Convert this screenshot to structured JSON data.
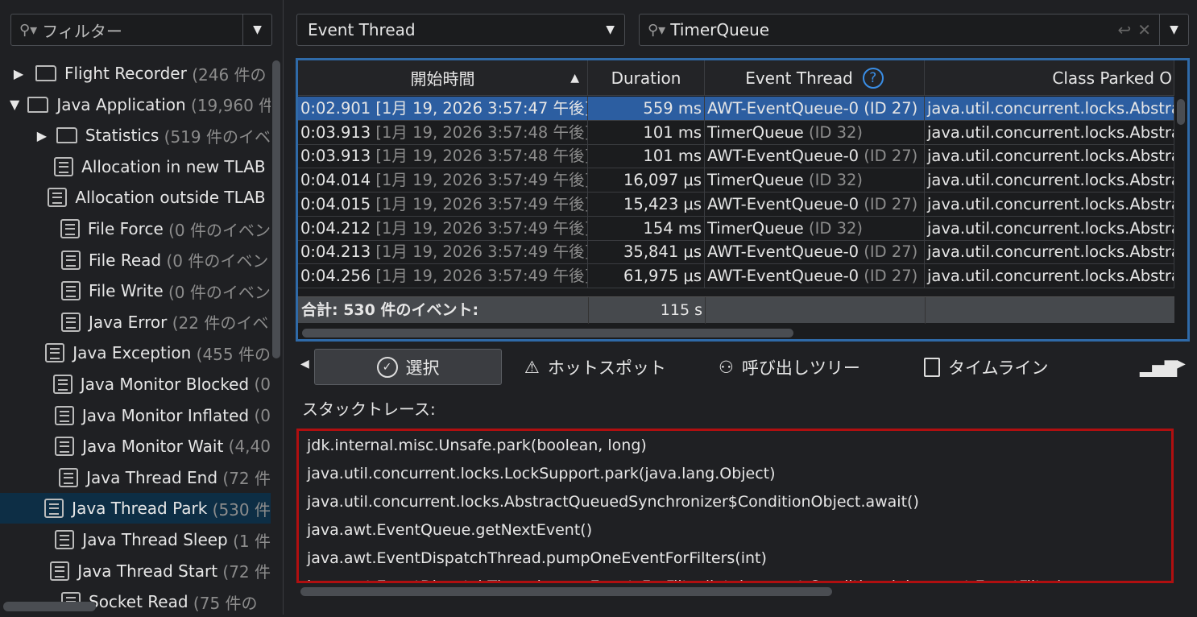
{
  "left": {
    "filter_placeholder": "フィルター",
    "tree": [
      {
        "label": "Flight Recorder",
        "count": "(246 件の",
        "level": 0,
        "type": "folder",
        "expand": "▶"
      },
      {
        "label": "Java Application",
        "count": "(19,960 件",
        "level": 0,
        "type": "folder-open",
        "expand": "▼"
      },
      {
        "label": "Statistics",
        "count": "(519 件のイベ",
        "level": 1,
        "type": "folder",
        "expand": "▶"
      },
      {
        "label": "Allocation in new TLAB",
        "count": "",
        "level": 1,
        "type": "doc"
      },
      {
        "label": "Allocation outside TLAB",
        "count": "",
        "level": 1,
        "type": "doc"
      },
      {
        "label": "File Force",
        "count": "(0 件のイベン",
        "level": 1,
        "type": "doc"
      },
      {
        "label": "File Read",
        "count": "(0 件のイベン",
        "level": 1,
        "type": "doc"
      },
      {
        "label": "File Write",
        "count": "(0 件のイベン",
        "level": 1,
        "type": "doc"
      },
      {
        "label": "Java Error",
        "count": "(22 件のイベ",
        "level": 1,
        "type": "doc"
      },
      {
        "label": "Java Exception",
        "count": "(455 件の",
        "level": 1,
        "type": "doc"
      },
      {
        "label": "Java Monitor Blocked",
        "count": "(0",
        "level": 1,
        "type": "doc"
      },
      {
        "label": "Java Monitor Inflated",
        "count": "(0",
        "level": 1,
        "type": "doc"
      },
      {
        "label": "Java Monitor Wait",
        "count": "(4,40",
        "level": 1,
        "type": "doc"
      },
      {
        "label": "Java Thread End",
        "count": "(72 件",
        "level": 1,
        "type": "doc"
      },
      {
        "label": "Java Thread Park",
        "count": "(530 件",
        "level": 1,
        "type": "doc",
        "selected": true
      },
      {
        "label": "Java Thread Sleep",
        "count": "(1 件",
        "level": 1,
        "type": "doc"
      },
      {
        "label": "Java Thread Start",
        "count": "(72 件",
        "level": 1,
        "type": "doc"
      },
      {
        "label": "Socket Read",
        "count": "(75 件の",
        "level": 1,
        "type": "doc"
      }
    ]
  },
  "toolbar": {
    "thread_select": "Event Thread",
    "search_value": "TimerQueue"
  },
  "table": {
    "headers": [
      "開始時間",
      "Duration",
      "Event Thread",
      "Class Parked O"
    ],
    "sort_indicator": "▲",
    "help_icon": "?",
    "rows": [
      {
        "time": "0:02.901",
        "date": "[1月 19, 2026 3:57:47 午後]",
        "duration": "559 ms",
        "thread": "AWT-EventQueue-0",
        "id": "(ID 27)",
        "class": "java.util.concurrent.locks.Abstrac",
        "selected": true
      },
      {
        "time": "0:03.913",
        "date": "[1月 19, 2026 3:57:48 午後]",
        "duration": "101 ms",
        "thread": "TimerQueue",
        "id": "(ID 32)",
        "class": "java.util.concurrent.locks.Abstrac"
      },
      {
        "time": "0:03.913",
        "date": "[1月 19, 2026 3:57:48 午後]",
        "duration": "101 ms",
        "thread": "AWT-EventQueue-0",
        "id": "(ID 27)",
        "class": "java.util.concurrent.locks.Abstrac"
      },
      {
        "time": "0:04.014",
        "date": "[1月 19, 2026 3:57:49 午後]",
        "duration": "16,097 μs",
        "thread": "TimerQueue",
        "id": "(ID 32)",
        "class": "java.util.concurrent.locks.Abstrac"
      },
      {
        "time": "0:04.015",
        "date": "[1月 19, 2026 3:57:49 午後]",
        "duration": "15,423 μs",
        "thread": "AWT-EventQueue-0",
        "id": "(ID 27)",
        "class": "java.util.concurrent.locks.Abstrac"
      },
      {
        "time": "0:04.212",
        "date": "[1月 19, 2026 3:57:49 午後]",
        "duration": "154 ms",
        "thread": "TimerQueue",
        "id": "(ID 32)",
        "class": "java.util.concurrent.locks.Abstrac"
      },
      {
        "time": "0:04.213",
        "date": "[1月 19, 2026 3:57:49 午後]",
        "duration": "35,841 μs",
        "thread": "AWT-EventQueue-0",
        "id": "(ID 27)",
        "class": "java.util.concurrent.locks.Abstrac"
      },
      {
        "time": "0:04.256",
        "date": "[1月 19, 2026 3:57:49 午後]",
        "duration": "61,975 μs",
        "thread": "AWT-EventQueue-0",
        "id": "(ID 27)",
        "class": "java.util.concurrent.locks.Abstrac"
      }
    ],
    "total_label": "合計: 530 件のイベント:",
    "total_duration": "115 s"
  },
  "tabs": [
    "選択",
    "ホットスポット",
    "呼び出しツリー",
    "タイムライン"
  ],
  "stack": {
    "label": "スタックトレース:",
    "lines": [
      "jdk.internal.misc.Unsafe.park(boolean, long)",
      "java.util.concurrent.locks.LockSupport.park(java.lang.Object)",
      "java.util.concurrent.locks.AbstractQueuedSynchronizer$ConditionObject.await()",
      "java.awt.EventQueue.getNextEvent()",
      "java.awt.EventDispatchThread.pumpOneEventForFilters(int)",
      "java.awt.EventDispatchThread.pumpEventsForFilter(int, java.awt.Conditional, java.awt.EventFilter)"
    ]
  }
}
